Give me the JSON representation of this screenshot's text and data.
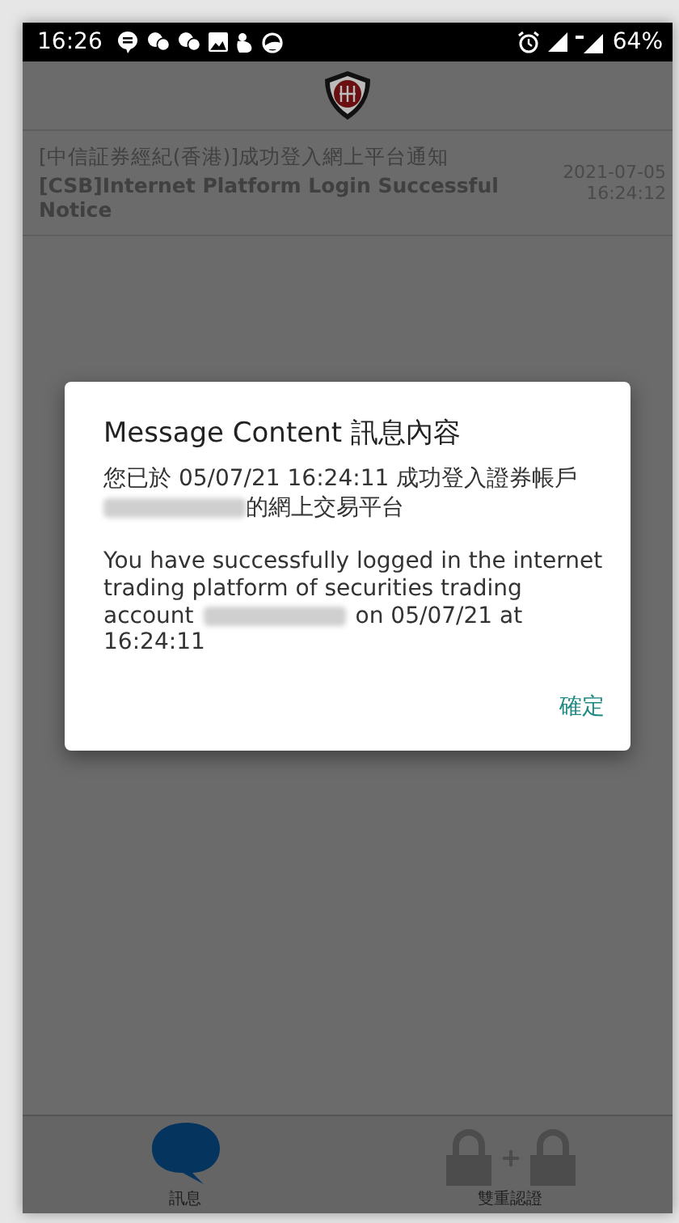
{
  "status_bar": {
    "time": "16:26",
    "battery": "64%"
  },
  "messages": [
    {
      "title_zh": "[中信証券經紀(香港)]成功登入網上平台通知",
      "title_en": "[CSB]Internet Platform Login Successful Notice",
      "date": "2021-07-05",
      "time": "16:24:12"
    }
  ],
  "dialog": {
    "title": "Message Content 訊息內容",
    "body_zh": {
      "before": "您已於 05/07/21 16:24:11 成功登入證券帳戶",
      "after": "的網上交易平台"
    },
    "body_en": {
      "lines": [
        "You have successfully logged in the internet",
        "trading platform of securities trading"
      ],
      "before": "account",
      "after": "on 05/07/21 at",
      "last": "16:24:11"
    },
    "button": "確定"
  },
  "tabs": [
    {
      "label": "訊息",
      "kind": "messages",
      "selected": true
    },
    {
      "label": "雙重認證",
      "kind": "two-factor",
      "selected": false
    }
  ]
}
